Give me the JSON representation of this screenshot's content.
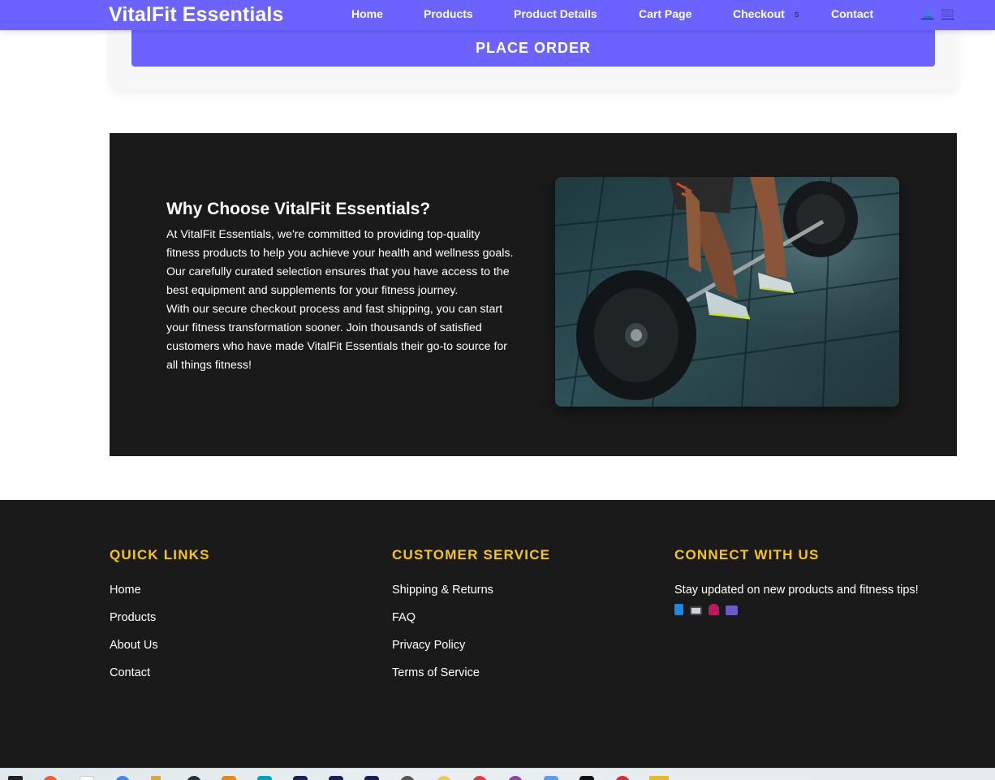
{
  "header": {
    "brand": "VitalFit Essentials",
    "nav": [
      "Home",
      "Products",
      "Product Details",
      "Cart Page",
      "Checkout",
      "Contact"
    ],
    "stray_text": "s",
    "icons": [
      "user-icon",
      "cart-icon"
    ]
  },
  "checkout": {
    "place_order_label": "PLACE ORDER"
  },
  "why": {
    "title": "Why Choose VitalFit Essentials?",
    "paragraph1": "At VitalFit Essentials, we're committed to providing top-quality fitness products to help you achieve your health and wellness goals. Our carefully curated selection ensures that you have access to the best equipment and supplements for your fitness journey.",
    "paragraph2": "With our secure checkout process and fast shipping, you can start your fitness transformation sooner. Join thousands of satisfied customers who have made VitalFit Essentials their go-to source for all things fitness!",
    "image": "barbell-deadlift-photo"
  },
  "footer": {
    "quick_links": {
      "heading": "QUICK LINKS",
      "links": [
        "Home",
        "Products",
        "About Us",
        "Contact"
      ]
    },
    "customer_service": {
      "heading": "CUSTOMER SERVICE",
      "links": [
        "Shipping & Returns",
        "FAQ",
        "Privacy Policy",
        "Terms of Service"
      ]
    },
    "connect": {
      "heading": "CONNECT WITH US",
      "text": "Stay updated on new products and fitness tips!",
      "social_icons": [
        "facebook-icon",
        "instagram-icon",
        "twitter-icon",
        "youtube-icon"
      ]
    }
  },
  "colors": {
    "primary": "#6c63ff",
    "dark": "#1b1a1b",
    "accent_heading": "#f5c518",
    "white": "#ffffff"
  },
  "taskbar": {
    "icons": [
      "epic-games-icon",
      "app-orange-icon",
      "app-white-icon",
      "chrome-icon",
      "app-pen-icon",
      "app-dark-icon",
      "app-orange-square-icon",
      "app-teal-icon",
      "app-navy-icon",
      "app-navy2-icon",
      "app-navy3-icon",
      "app-gray-icon",
      "app-yellow-icon",
      "app-red-icon",
      "app-purple-icon",
      "calendar-icon",
      "app-black-icon",
      "app-red2-icon",
      "folder-icon"
    ]
  }
}
